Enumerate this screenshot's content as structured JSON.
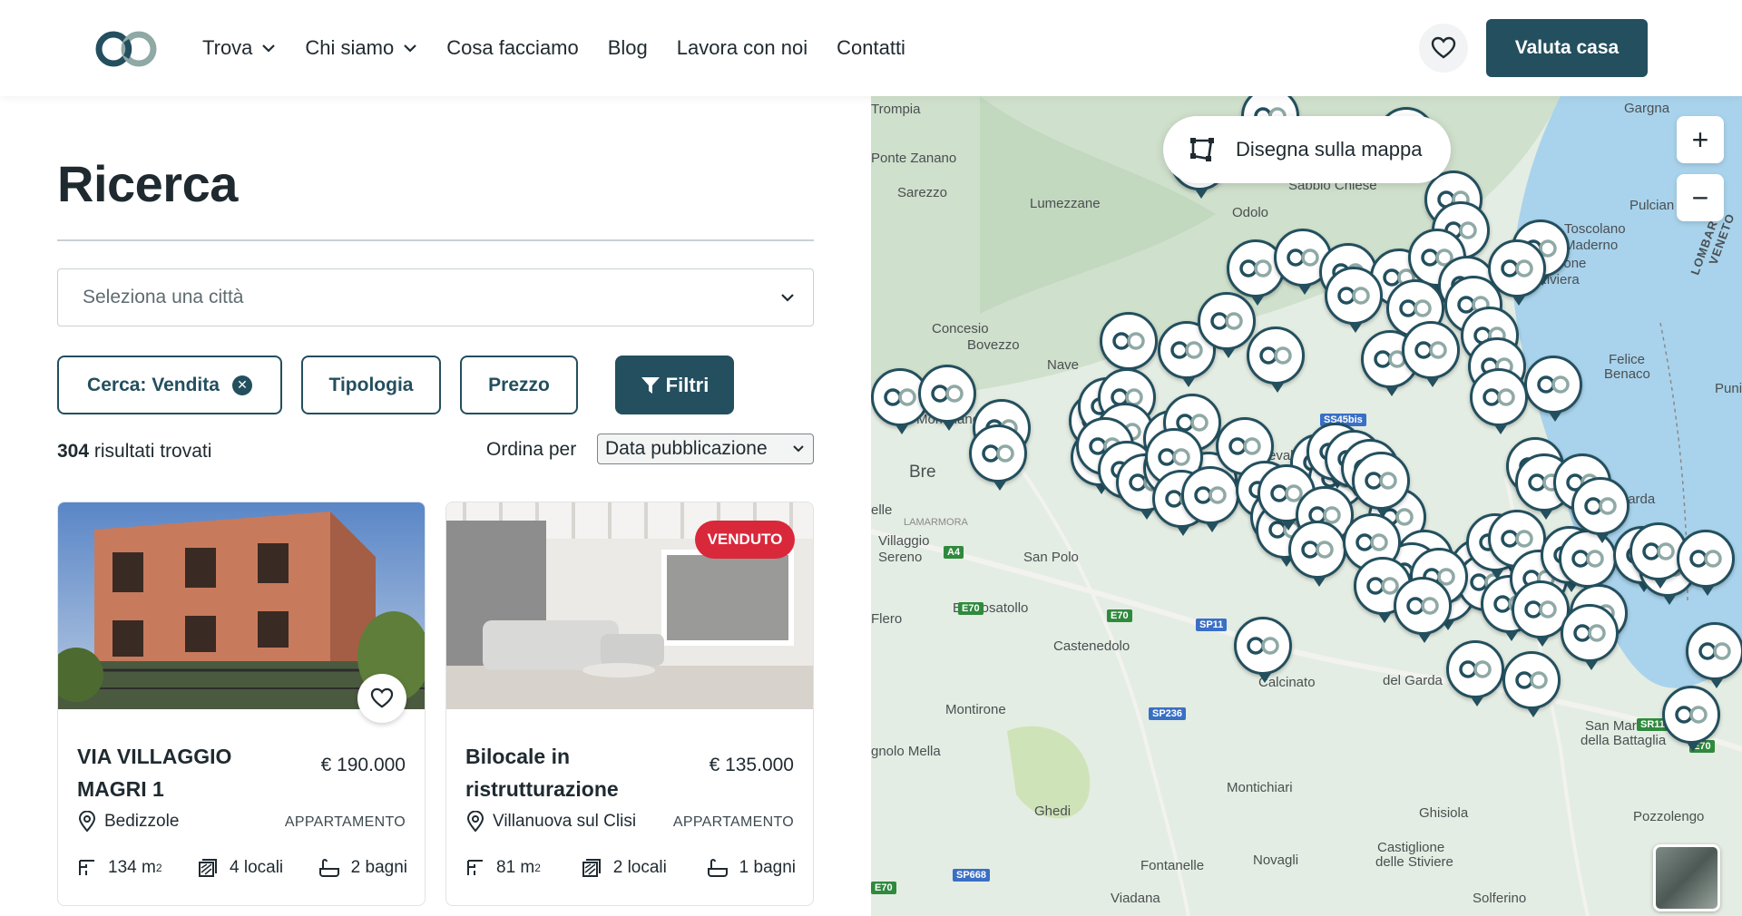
{
  "header": {
    "nav": [
      {
        "label": "Trova",
        "dropdown": true
      },
      {
        "label": "Chi siamo",
        "dropdown": true
      },
      {
        "label": "Cosa facciamo",
        "dropdown": false
      },
      {
        "label": "Blog",
        "dropdown": false
      },
      {
        "label": "Lavora con noi",
        "dropdown": false
      },
      {
        "label": "Contatti",
        "dropdown": false
      }
    ],
    "cta_label": "Valuta casa",
    "favorites_icon": "heart-icon"
  },
  "search": {
    "title": "Ricerca",
    "city_placeholder": "Seleziona una città",
    "chip_search": "Cerca: Vendita",
    "chip_type": "Tipologia",
    "chip_price": "Prezzo",
    "chip_filters": "Filtri",
    "results_count": "304",
    "results_suffix": " risultati trovati",
    "sort_label": "Ordina per",
    "sort_value": "Data pubblicazione"
  },
  "listings": [
    {
      "title": "VIA VILLAGGIO MAGRI 1",
      "price": "€ 190.000",
      "location": "Bedizzole",
      "type": "APPARTAMENTO",
      "area": "134 m",
      "rooms": "4 locali",
      "baths": "2 bagni",
      "badge": ""
    },
    {
      "title": "Bilocale in ristrutturazione",
      "price": "€ 135.000",
      "location": "Villanuova sul Clisi",
      "type": "APPARTAMENTO",
      "area": "81 m",
      "rooms": "2 locali",
      "baths": "1 bagni",
      "badge": "VENDUTO"
    }
  ],
  "map": {
    "draw_label": "Disegna sulla mappa",
    "zoom_in": "+",
    "zoom_out": "−",
    "labels": [
      "Gargna",
      "Trompia",
      "Ponte Zanano",
      "Sabbio Chiese",
      "Sarezzo",
      "Lumezzane",
      "Odolo",
      "Pulcian",
      "Toscolano",
      "Maderno",
      "Gardone",
      "Riviera",
      "LOMBARDY",
      "VENETO",
      "Concesio",
      "Bovezzo",
      "Nave",
      "Felice",
      "Benaco",
      "Mompiano",
      "Prevalle",
      "Bre",
      "Moniga del Garda",
      "Villaggio",
      "Sereno",
      "San Polo",
      "LAMARMORA",
      "Flero",
      "Borgosatollo",
      "Castenedolo",
      "Calcinato",
      "del Garda",
      "Montirone",
      "Montichiari",
      "Ghedi",
      "Ghisiola",
      "Castiglione",
      "delle Stiviere",
      "Fontanelle",
      "Novagli",
      "Viadana",
      "Solferino",
      "Pozzolengo",
      "San Martino",
      "della Battaglia",
      "gnolo Mella",
      "Puni",
      "elle"
    ],
    "roads": [
      "A4",
      "E70",
      "E70",
      "SP11",
      "SP236",
      "SP668",
      "SS45bis",
      "SR11",
      "E70",
      "E70"
    ]
  },
  "colors": {
    "brand": "#234f5e",
    "sold": "#d9283a",
    "water": "#a9d3ec",
    "land": "#e7efe6"
  }
}
